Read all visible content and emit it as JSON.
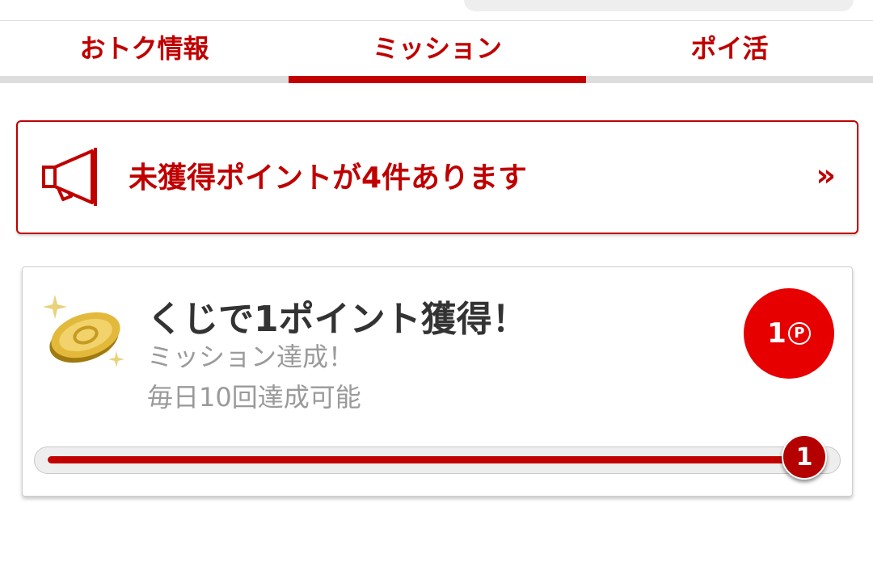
{
  "tabs": [
    {
      "label": "おトク情報",
      "active": false
    },
    {
      "label": "ミッション",
      "active": true
    },
    {
      "label": "ポイ活",
      "active": false
    }
  ],
  "notice": {
    "text": "未獲得ポイントが4件あります",
    "chevron": "»",
    "icon": "megaphone-icon"
  },
  "mission": {
    "title": "くじで1ポイント獲得！",
    "status": "ミッション達成！",
    "limit": "毎日10回達成可能",
    "reward_points": "1",
    "reward_unit": "P",
    "progress_label": "1",
    "progress_fraction": 1.0,
    "icon": "gold-coin-icon"
  },
  "colors": {
    "accent": "#c00000",
    "badge": "#e60000",
    "tab_inactive_bar": "#dddddd"
  }
}
